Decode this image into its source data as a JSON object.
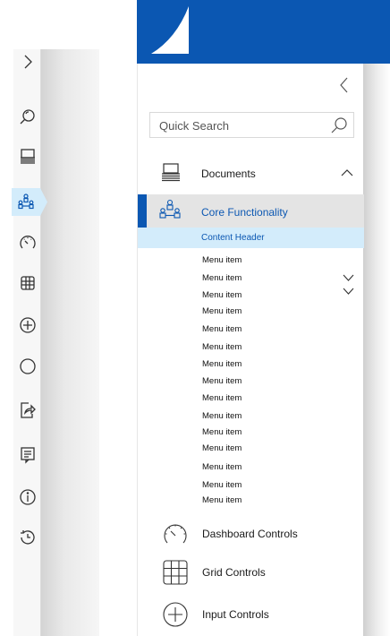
{
  "rail": {
    "expand_icon": "chevron-right-icon",
    "icons": [
      "search-icon",
      "documents-icon",
      "core-functionality-icon",
      "dashboard-icon",
      "grid-icon",
      "add-icon",
      "circle-icon",
      "share-icon",
      "form-icon",
      "info-icon",
      "history-icon"
    ]
  },
  "panel": {
    "search_placeholder": "Quick Search",
    "documents_label": "Documents",
    "core_label": "Core Functionality",
    "content_header": "Content Header",
    "menu_items": [
      "Menu item",
      "Menu item",
      "Menu item",
      "Menu item",
      "Menu item",
      "Menu item",
      "Menu item",
      "Menu item",
      "Menu item",
      "Menu item",
      "Menu item",
      "Menu item",
      "Menu item",
      "Menu item",
      "Menu item"
    ],
    "bottom_items": [
      "Dashboard Controls",
      "Grid Controls",
      "Input Controls"
    ]
  },
  "colors": {
    "brand": "#0b57b2",
    "highlight": "#d3ecfb"
  }
}
